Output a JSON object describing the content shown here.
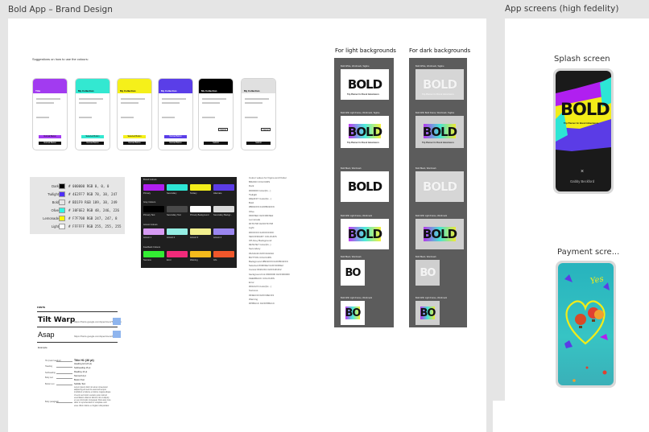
{
  "frames": {
    "left_title": "Bold App – Brand Design",
    "right_title": "App screens (high fedelity)"
  },
  "suggestions": "Suggestions on how to use the colours:",
  "mockups": [
    {
      "title": "Title",
      "head_color": "#a23bf0",
      "btn_color": "#a23bf0",
      "btn_label": "Normal Button",
      "btn2_label": "Normal Button"
    },
    {
      "title": "My Collection",
      "head_color": "#33e8d1",
      "btn_color": "#33e8d1",
      "btn_label": "Selected Button",
      "btn2_label": "Normal Button"
    },
    {
      "title": "My Collection",
      "head_color": "#f5f01a",
      "btn_color": "#f5f01a",
      "btn_label": "Selected Button",
      "btn2_label": "Normal Button"
    },
    {
      "title": "My Collection",
      "head_color": "#5a3ee8",
      "btn_color": "#5a3ee8",
      "btn_label": "Normal Button",
      "btn2_label": "Normal Button"
    },
    {
      "title": "My Collection",
      "head_color": "#000000",
      "btn_color": "#f2f2f2",
      "btn_label": "Cancel",
      "btn2_label": "Submit"
    },
    {
      "title": "My Collection",
      "head_color": "#e0e0e0",
      "btn_color": "#ffffff",
      "btn_label": "Cancel",
      "btn2_label": "Submit"
    }
  ],
  "palette": [
    {
      "name": "Dark",
      "color": "#000000",
      "hex": "# 000000  RGB 0, 0, 0"
    },
    {
      "name": "Twilight",
      "color": "#4e2ff7",
      "hex": "# 4E2FF7  RGB 78, 38, 247"
    },
    {
      "name": "Bold",
      "color": "#bd1f9",
      "hex": "# BD1F9  RGB 189, 38, 249"
    },
    {
      "name": "Olive",
      "color": "#30f6e2",
      "hex": "# 30F6E2  RGB 48, 246, 226"
    },
    {
      "name": "Lemonade",
      "color": "#f7f708",
      "hex": "# F7F708  RGB 247, 247, 8"
    },
    {
      "name": "Light",
      "color": "#ffffff",
      "hex": "# FFFFFF  RGB 255, 255, 255"
    }
  ],
  "swatch_grid": {
    "section1": "Brand Colours",
    "section2": "Grey Colours",
    "section3": "Accent Colours",
    "section4": "Feedback Colours",
    "row1": [
      {
        "label": "Primary",
        "color": "#b01ff0"
      },
      {
        "label": "Secondary",
        "color": "#2de6d5"
      },
      {
        "label": "Tertiary",
        "color": "#f3ee1a"
      },
      {
        "label": "Alternate",
        "color": "#5b3ce6"
      }
    ],
    "row2": [
      {
        "label": "Primary Text",
        "color": "#000000"
      },
      {
        "label": "Secondary Text",
        "color": "#4a4a4a"
      },
      {
        "label": "Primary Background",
        "color": "#ffffff"
      },
      {
        "label": "Secondary Backgr...",
        "color": "#d9d9d9"
      }
    ],
    "row3": [
      {
        "label": "Accent 1",
        "color": "#d69af2"
      },
      {
        "label": "Accent 2",
        "color": "#94eee4"
      },
      {
        "label": "Accent 3",
        "color": "#f2f08f"
      },
      {
        "label": "Accent 4",
        "color": "#9a86ef"
      }
    ],
    "row4": [
      {
        "label": "Success",
        "color": "#33ec33"
      },
      {
        "label": "Error",
        "color": "#f02a7a"
      },
      {
        "label": "Warning",
        "color": "#f5ba1c"
      },
      {
        "label": "Info",
        "color": "#f0572b"
      }
    ]
  },
  "code_notes": [
    "Colour values for Figma and Flutter",
    "BRAND COLOURS",
    "Dark",
    "#000000   Color(0x...)",
    "Twilight",
    "#4E2FF7   Color(0x...)",
    "Bold",
    "#BD1FF9   0xFFBD1FF9",
    "Olive",
    "#30F6E2   0xFF30F6E2",
    "Lemonade",
    "#F7F708   0xFFF7F708",
    "Light",
    "#FFFFFF   0xFFFFFFFF",
    "SECONDARY COLOURS",
    "Off-Grey Background",
    "#E7E7E7   Color(0x..)",
    "Secondary",
    "#4A4A4A   0xFF4A4A4A",
    "BUTTON COLOURS",
    "Background   #BD1FF9   0xFFBD1FF9",
    "Selected    #30F6E2   0xFF30F6E2",
    "Cancel      #F2F2F2   0xFFF2F2F2",
    "background Ink   #000000   0xFF000000",
    "FEEDBACK COLOURS",
    "Error",
    "#F02A7A   Color(0x...)",
    "Success",
    "#33EC33   0xFF33EC33",
    "Warning",
    "#F5BA1C   0xFFF5BA1C"
  ],
  "fonts_block": {
    "heading": "FONTS",
    "font1": "Tilt Warp",
    "font1_url": "https://fonts.google.com/specimen/Tilt+Warp",
    "font2": "Asap",
    "font2_url": "https://fonts.google.com/specimen/Asap",
    "example": "Example",
    "spec_labels": [
      "H1 (main heading)",
      "Heading",
      "Subheading",
      "Body text",
      "Button text",
      "Body paragraph"
    ],
    "spec_values": [
      "Title H1 (36 pt)",
      "Heading H2 (24 pt)",
      "Subheading 16 pt",
      "Reading 14 pt",
      "Normal 14 pt",
      "Button Text",
      "Subtitle Text"
    ],
    "paragraph": "Lorem ipsum dolor sit amet consectetur adipiscing elit sed do eiusmod tempor incididunt ut labore et dolore magna aliqua. Ut enim ad minim veniam quis nostrud exercitation ullamco laboris nisi ut aliquip ex ea commodo consequat. Duis aute irure dolor in reprehenderit in voluptate velit esse cillum dolore eu fugiat nulla pariatur."
  },
  "logos": {
    "light_title": "For light backgrounds",
    "dark_title": "For dark backgrounds",
    "word": "BOLD",
    "tagline": "Trip Planner for Bored Adventurers",
    "short": "BO",
    "light_captions": [
      "Bold White, Wordmark, Tagline",
      "Bold With Light Frame, Wordmark, Tagline",
      "Bold Black, Wordmark",
      "Bold With Light Frame, Wordmark",
      "Bold Black, Wordmark",
      "Bold With Light Frame, Wordmark"
    ],
    "dark_captions": [
      "Bold White, Wordmark, Tagline",
      "Bold With Bold Frame, Wordmark, Tagline",
      "Bold Black, Wordmark",
      "Bold With Light Frame, Wordmark",
      "Bold Black, Wordmark",
      "Bold With Light Frame, Wordmark"
    ]
  },
  "screens": {
    "splash_label": "Splash screen",
    "splash_word": "BOLD",
    "splash_tagline": "Trip Planner for Bored Adventurers",
    "splash_name": "Gabby Beckford",
    "payment_label": "Payment scre...",
    "payment_yes": "Yes"
  }
}
